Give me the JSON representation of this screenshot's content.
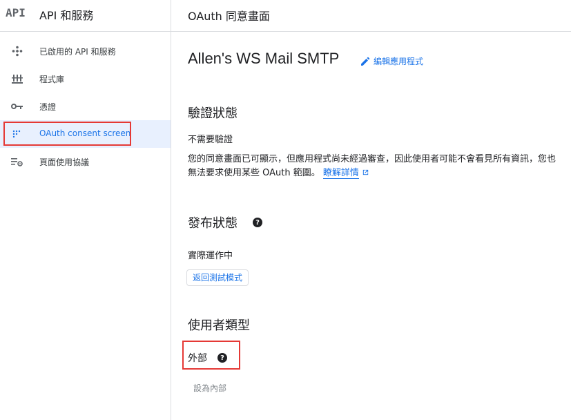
{
  "sidebar": {
    "logo": "API",
    "title": "API 和服務",
    "items": [
      {
        "label": "已啟用的 API 和服務",
        "icon": "api-diamond-icon"
      },
      {
        "label": "程式庫",
        "icon": "library-icon"
      },
      {
        "label": "憑證",
        "icon": "key-icon"
      },
      {
        "label": "OAuth consent screen",
        "icon": "consent-dots-icon",
        "active": true
      },
      {
        "label": "頁面使用協議",
        "icon": "settings-list-icon"
      }
    ]
  },
  "header": {
    "title": "OAuth 同意畫面"
  },
  "app": {
    "name": "Allen's WS Mail SMTP",
    "edit_label": "編輯應用程式"
  },
  "verification": {
    "title": "驗證狀態",
    "status": "不需要驗證",
    "description": "您的同意畫面已可顯示，但應用程式尚未經過審查，因此使用者可能不會看見所有資訊，您也無法要求使用某些 OAuth 範圍。",
    "learn_more": "瞭解詳情"
  },
  "publishing": {
    "title": "發布狀態",
    "status": "實際運作中",
    "button": "返回測試模式"
  },
  "user_type": {
    "title": "使用者類型",
    "value": "外部",
    "button": "設為內部"
  },
  "colors": {
    "accent": "#1a73e8",
    "active_bg": "#e8f0fe",
    "highlight": "#e53935"
  }
}
